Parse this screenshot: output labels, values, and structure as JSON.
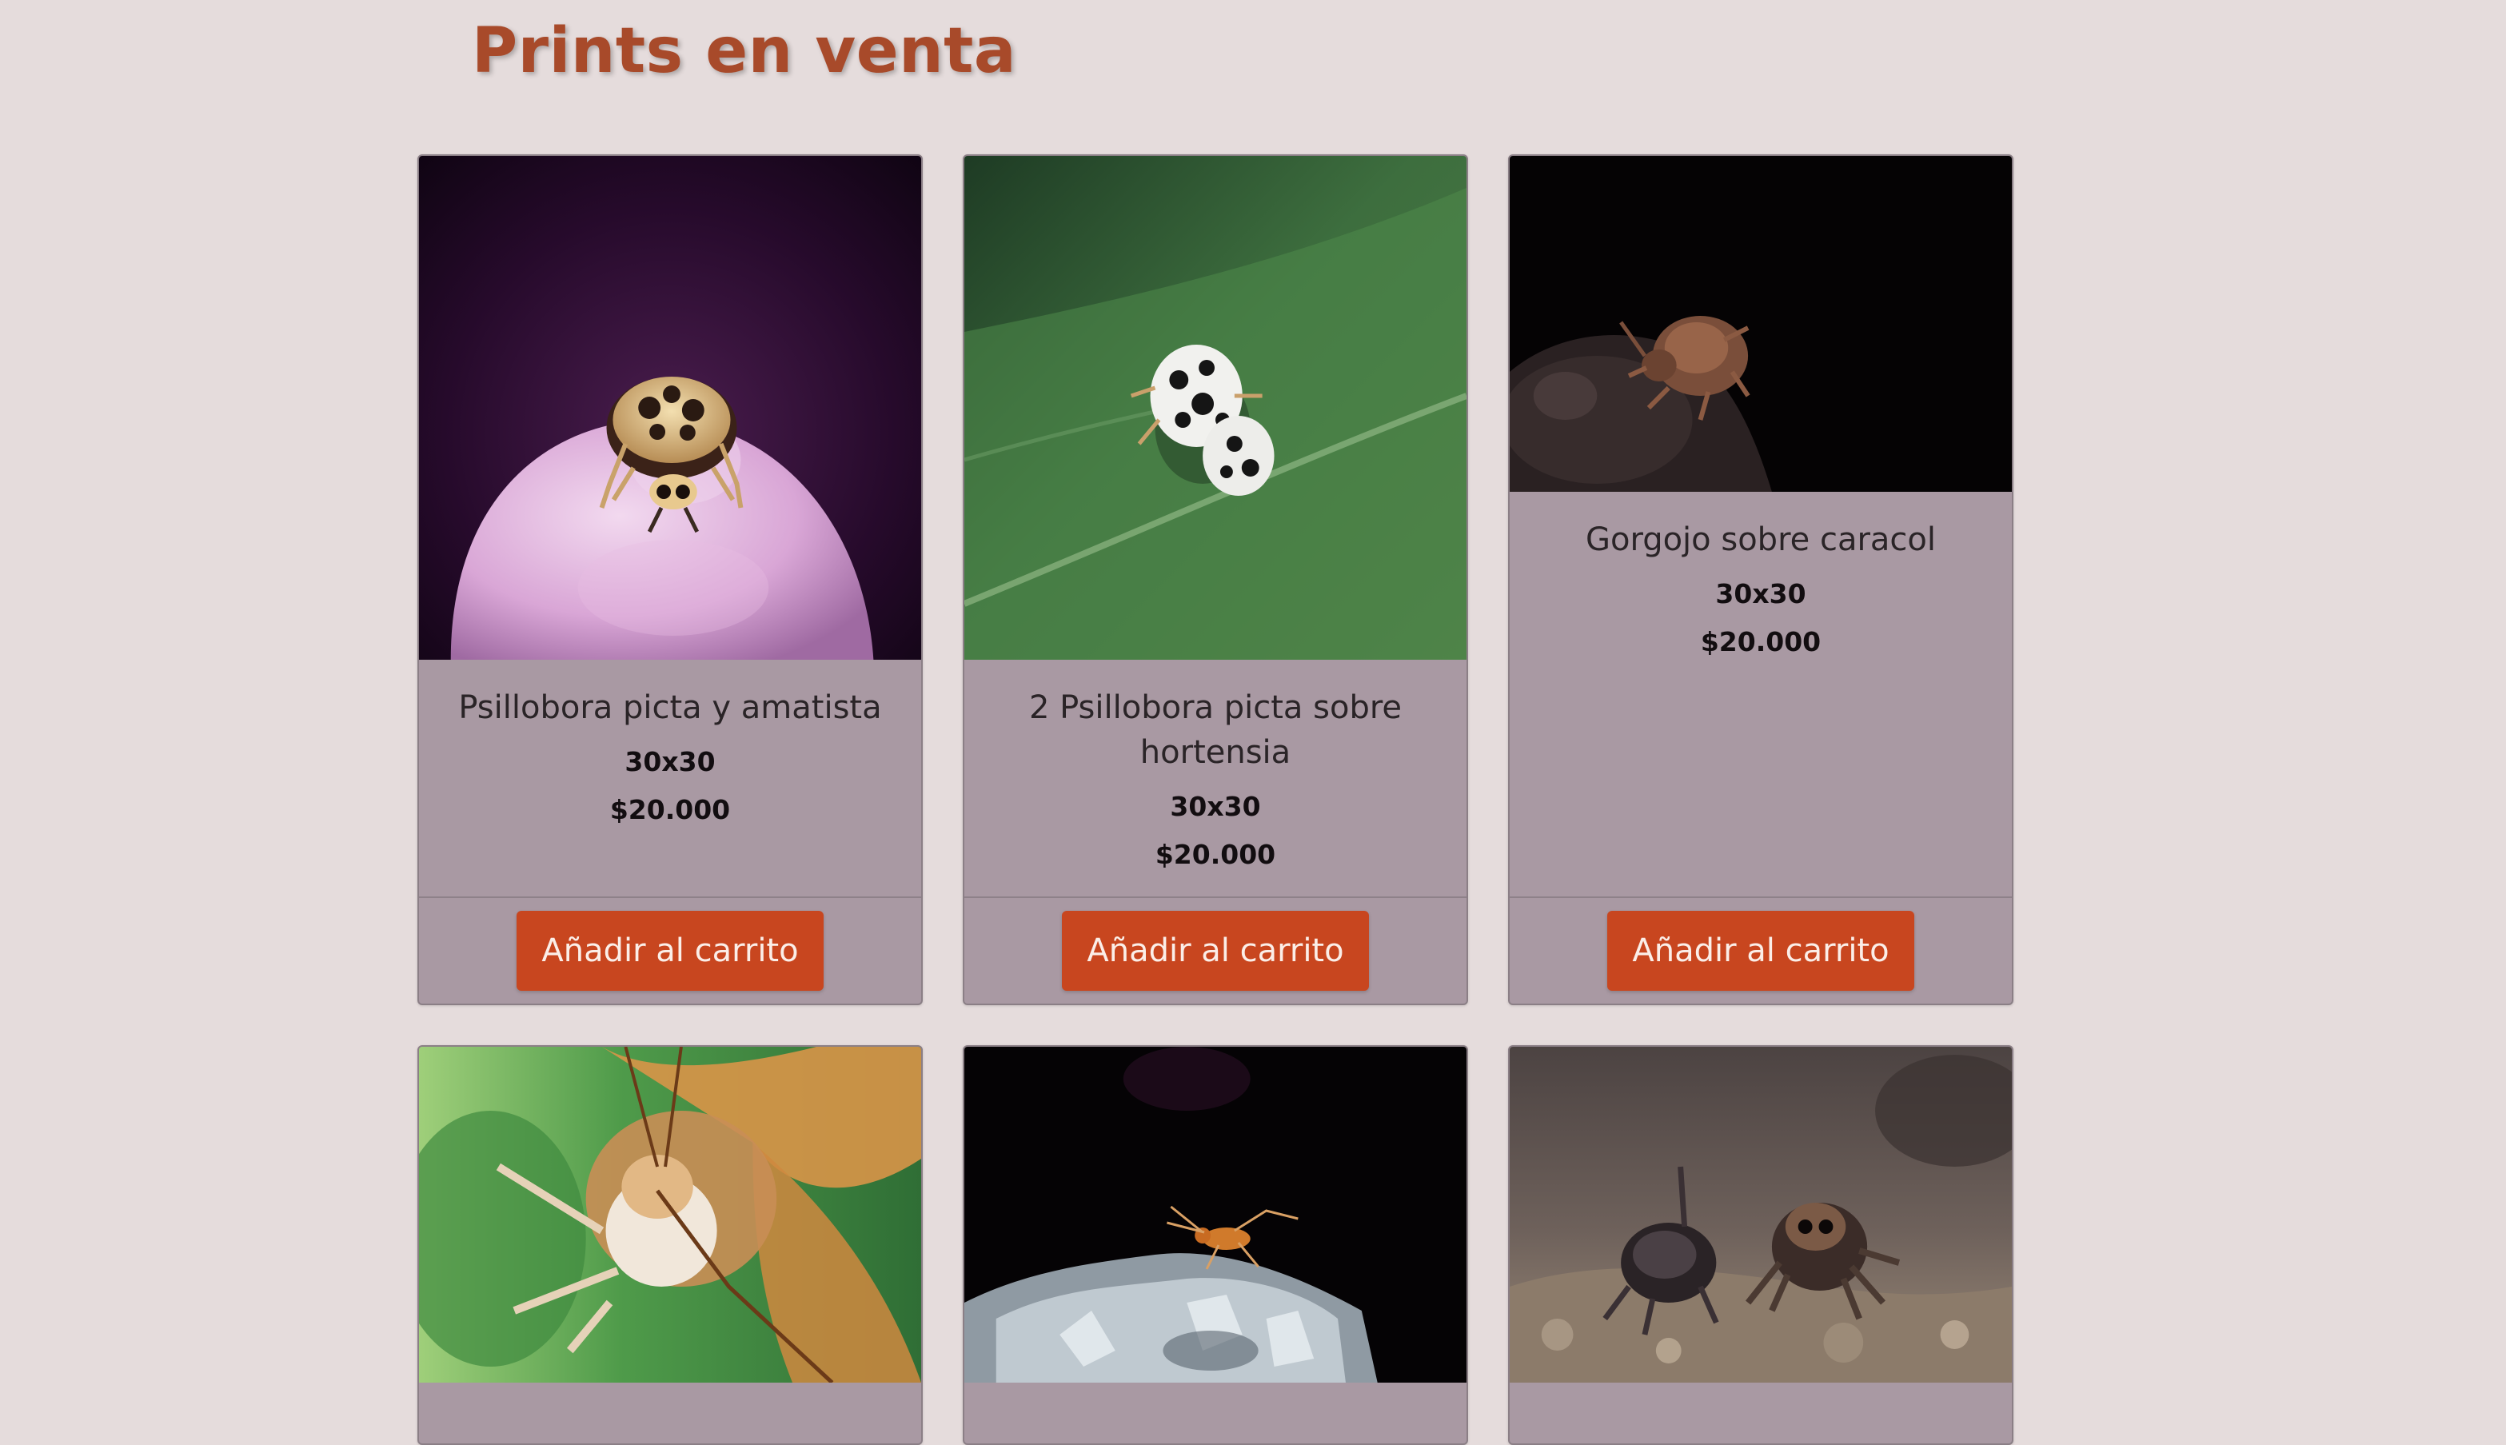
{
  "page": {
    "title": "Prints en venta"
  },
  "products": [
    {
      "title": "Psillobora picta y amatista",
      "size": "30x30",
      "price": "$20.000",
      "button_label": "Añadir al carrito",
      "image_subject": "ladybug on purple amethyst"
    },
    {
      "title": "2 Psillobora picta sobre hortensia",
      "size": "30x30",
      "price": "$20.000",
      "button_label": "Añadir al carrito",
      "image_subject": "two spotted ladybugs on green leaf"
    },
    {
      "title": "Gorgojo sobre caracol",
      "size": "30x30",
      "price": "$20.000",
      "button_label": "Añadir al carrito",
      "image_subject": "weevil on snail shell, black background"
    },
    {
      "image_subject": "butterfly close-up, green and orange"
    },
    {
      "image_subject": "small orange insect on crystal rock, dark background"
    },
    {
      "image_subject": "two jumping spiders on soil"
    }
  ],
  "colors": {
    "background": "#e5dcdc",
    "title": "#a84a2a",
    "card": "#a999a3",
    "button": "#c8461f",
    "button_text": "#fbeee8"
  }
}
